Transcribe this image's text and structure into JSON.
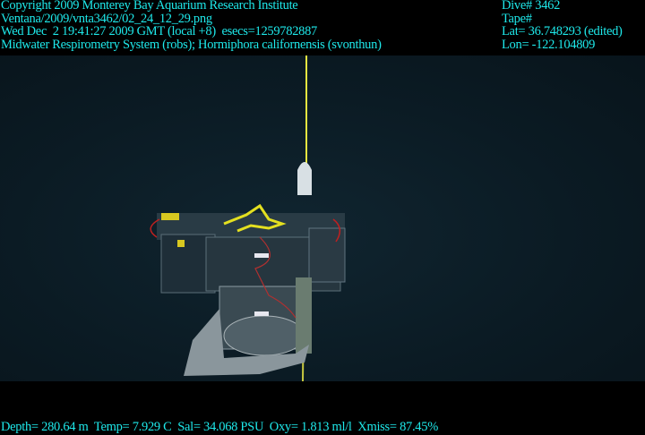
{
  "header": {
    "copyright": "Copyright 2009 Monterey Bay Aquarium Research Institute",
    "file": "Ventana/2009/vnta3462/02_24_12_29.png",
    "datetime": "Wed Dec  2 19:41:27 2009 GMT (local +8)  esecs=1259782887",
    "description": "Midwater Respirometry System (robs); Hormiphora californensis (svonthun)",
    "dive": "Dive# 3462",
    "tape": "Tape#",
    "lat": "Lat= 36.748293 (edited)",
    "lon": "Lon= -122.104809"
  },
  "footer": {
    "sensors": "Depth= 280.64 m  Temp= 7.929 C  Sal= 34.068 PSU  Oxy= 1.813 ml/l  Xmiss= 87.45%"
  },
  "colors": {
    "overlay_text": "#1ee8ea",
    "water": "#0b1b24",
    "tether": "#e6e640"
  }
}
